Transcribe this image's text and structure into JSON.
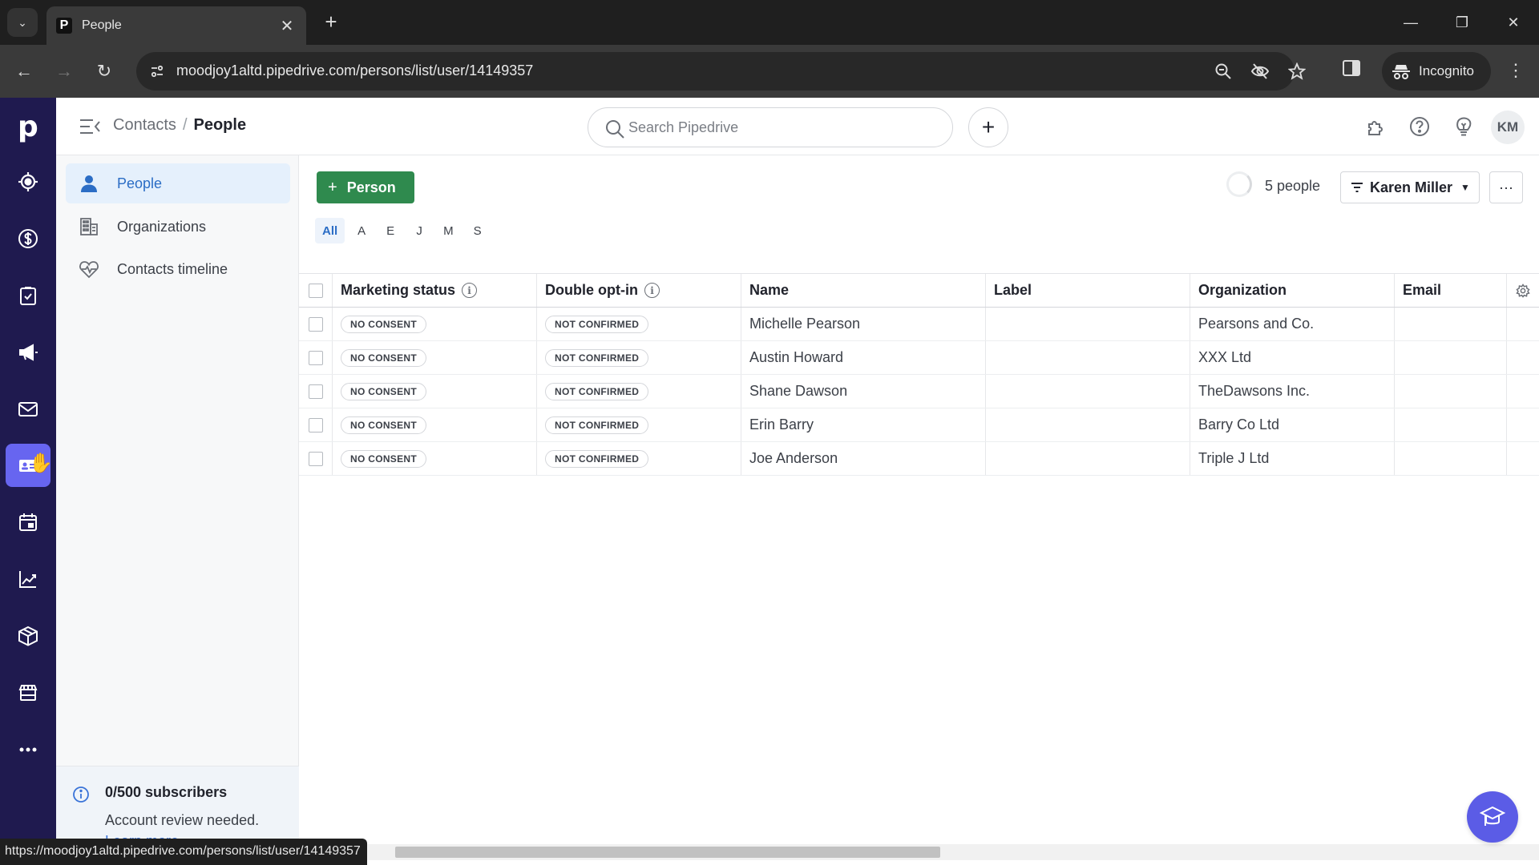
{
  "browser": {
    "tab_title": "People",
    "tab_favicon": "P",
    "url": "moodjoy1altd.pipedrive.com/persons/list/user/14149357",
    "incognito_label": "Incognito",
    "status_url": "https://moodjoy1altd.pipedrive.com/persons/list/user/14149357"
  },
  "rail": {
    "logo": "p",
    "items": [
      {
        "icon": "target-icon",
        "label": "Leads"
      },
      {
        "icon": "dollar-icon",
        "label": "Deals"
      },
      {
        "icon": "clipboard-check-icon",
        "label": "Projects"
      },
      {
        "icon": "megaphone-icon",
        "label": "Campaigns"
      },
      {
        "icon": "mail-icon",
        "label": "Mail"
      },
      {
        "icon": "contacts-card-icon",
        "label": "Contacts",
        "active": true
      },
      {
        "icon": "calendar-icon",
        "label": "Activities"
      },
      {
        "icon": "chart-icon",
        "label": "Insights"
      },
      {
        "icon": "box-icon",
        "label": "Products"
      },
      {
        "icon": "store-icon",
        "label": "Marketplace"
      },
      {
        "icon": "more-icon",
        "label": "More"
      }
    ]
  },
  "header": {
    "breadcrumb_parent": "Contacts",
    "breadcrumb_sep": "/",
    "breadcrumb_current": "People",
    "search_placeholder": "Search Pipedrive",
    "avatar_initials": "KM"
  },
  "subnav": {
    "items": [
      {
        "label": "People",
        "active": true
      },
      {
        "label": "Organizations"
      },
      {
        "label": "Contacts timeline"
      }
    ],
    "subscribers_title": "0/500 subscribers",
    "subscribers_text": "Account review needed.",
    "subscribers_link": "Learn more"
  },
  "main": {
    "add_button_label": "Person",
    "alphabet": [
      "All",
      "A",
      "E",
      "J",
      "M",
      "S"
    ],
    "active_letter": "All",
    "count_label": "5 people",
    "filter_label": "Karen Miller",
    "more_label": "···"
  },
  "table": {
    "columns": [
      "Marketing status",
      "Double opt-in",
      "Name",
      "Label",
      "Organization",
      "Email"
    ],
    "rows": [
      {
        "marketing_status": "NO CONSENT",
        "double_opt_in": "NOT CONFIRMED",
        "name": "Michelle Pearson",
        "label": "",
        "organization": "Pearsons and Co.",
        "email": ""
      },
      {
        "marketing_status": "NO CONSENT",
        "double_opt_in": "NOT CONFIRMED",
        "name": "Austin Howard",
        "label": "",
        "organization": "XXX Ltd",
        "email": ""
      },
      {
        "marketing_status": "NO CONSENT",
        "double_opt_in": "NOT CONFIRMED",
        "name": "Shane Dawson",
        "label": "",
        "organization": "TheDawsons Inc.",
        "email": ""
      },
      {
        "marketing_status": "NO CONSENT",
        "double_opt_in": "NOT CONFIRMED",
        "name": "Erin Barry",
        "label": "",
        "organization": "Barry Co Ltd",
        "email": ""
      },
      {
        "marketing_status": "NO CONSENT",
        "double_opt_in": "NOT CONFIRMED",
        "name": "Joe Anderson",
        "label": "",
        "organization": "Triple J Ltd",
        "email": ""
      }
    ]
  },
  "colors": {
    "rail_bg": "#1f1a4f",
    "rail_active": "#6765f0",
    "primary_green": "#2f8a4e",
    "link_blue": "#2b6dc5",
    "academy_button": "#5b5ce6"
  }
}
